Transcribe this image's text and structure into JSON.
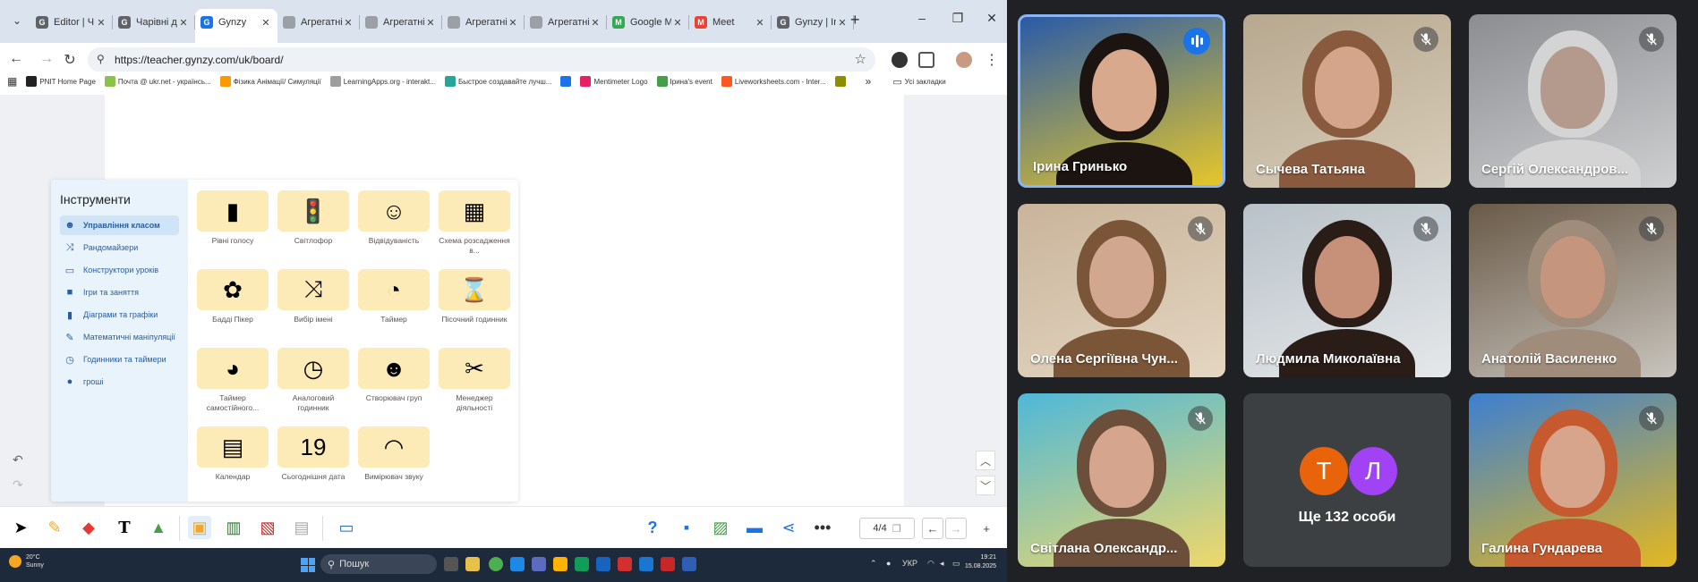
{
  "browser": {
    "tabs": [
      {
        "title": "Editor | Ч",
        "fav_color": "#5f6368",
        "fav_glyph": "G"
      },
      {
        "title": "Чарівні д",
        "fav_color": "#5f6368",
        "fav_glyph": "G"
      },
      {
        "title": "Gynzy",
        "fav_color": "#1a73e8",
        "fav_glyph": "G",
        "active": true
      },
      {
        "title": "Агрегатні",
        "fav_color": "#9aa0a6",
        "fav_glyph": ""
      },
      {
        "title": "Агрегатні",
        "fav_color": "#9aa0a6",
        "fav_glyph": ""
      },
      {
        "title": "Агрегатні",
        "fav_color": "#9aa0a6",
        "fav_glyph": ""
      },
      {
        "title": "Агрегатні",
        "fav_color": "#9aa0a6",
        "fav_glyph": ""
      },
      {
        "title": "Google M",
        "fav_color": "#34a853",
        "fav_glyph": "M"
      },
      {
        "title": "Meet",
        "fav_color": "#ea4335",
        "fav_glyph": "M"
      },
      {
        "title": "Gynzy | In",
        "fav_color": "#5f6368",
        "fav_glyph": "G"
      }
    ],
    "url": "https://teacher.gynzy.com/uk/board/",
    "bookmarks": [
      {
        "label": "PNIT Home Page",
        "color": "#222"
      },
      {
        "label": "Почта @ ukr.net - українсь...",
        "color": "#8bc34a"
      },
      {
        "label": "Фізика Анімації/ Симуляції",
        "color": "#ff9800"
      },
      {
        "label": "LearningApps.org - interakt...",
        "color": "#9e9e9e"
      },
      {
        "label": "Быстрое создавайте лучш...",
        "color": "#26a69a"
      },
      {
        "label": "",
        "color": "#1a73e8"
      },
      {
        "label": "Mentimeter Logo",
        "color": "#e91e63"
      },
      {
        "label": "Ірина's event",
        "color": "#43a047"
      },
      {
        "label": "Liveworksheets.com - Inter...",
        "color": "#ff5722"
      },
      {
        "label": "",
        "color": "#8d8d00"
      }
    ],
    "bookmarks_folder": "Усі закладки"
  },
  "tools": {
    "title": "Інструменти",
    "categories": [
      {
        "label": "Управління класом",
        "icon": "class-icon",
        "glyph": "☻",
        "active": true
      },
      {
        "label": "Рандомайзери",
        "icon": "shuffle-icon",
        "glyph": "⤨"
      },
      {
        "label": "Конструктори уроків",
        "icon": "builder-icon",
        "glyph": "▭"
      },
      {
        "label": "Ігри та заняття",
        "icon": "games-icon",
        "glyph": "■"
      },
      {
        "label": "Діаграми та графіки",
        "icon": "chart-icon",
        "glyph": "▮"
      },
      {
        "label": "Математичні маніпуляції",
        "icon": "ruler-icon",
        "glyph": "✎"
      },
      {
        "label": "Годинники та таймери",
        "icon": "clock-icon",
        "glyph": "◷"
      },
      {
        "label": "гроші",
        "icon": "coins-icon",
        "glyph": "●"
      }
    ],
    "items": [
      {
        "label": "Рівні голосу",
        "icon": "voice-level-icon",
        "glyph": "▮"
      },
      {
        "label": "Світлофор",
        "icon": "traffic-light-icon",
        "glyph": "🚦"
      },
      {
        "label": "Відвідуваність",
        "icon": "attendance-icon",
        "glyph": "☺"
      },
      {
        "label": "Схема розсадження в...",
        "icon": "seating-icon",
        "glyph": "▦"
      },
      {
        "label": "Бадді Пікер",
        "icon": "buddy-picker-icon",
        "glyph": "✿"
      },
      {
        "label": "Вибір імені",
        "icon": "name-picker-icon",
        "glyph": "⤨"
      },
      {
        "label": "Таймер",
        "icon": "timer-icon",
        "glyph": "◔"
      },
      {
        "label": "Пісочний годинник",
        "icon": "hourglass-icon",
        "glyph": "⌛"
      },
      {
        "label": "Таймер самостійного...",
        "icon": "pie-timer-icon",
        "glyph": "◕"
      },
      {
        "label": "Аналоговий годинник",
        "icon": "analog-clock-icon",
        "glyph": "◷"
      },
      {
        "label": "Створювач груп",
        "icon": "group-maker-icon",
        "glyph": "☻"
      },
      {
        "label": "Менеджер діяльності",
        "icon": "activity-manager-icon",
        "glyph": "✂"
      },
      {
        "label": "Календар",
        "icon": "calendar-icon",
        "glyph": "▤"
      },
      {
        "label": "Сьогоднішня дата",
        "icon": "today-date-icon",
        "glyph": "19"
      },
      {
        "label": "Вимірювач звуку",
        "icon": "sound-meter-icon",
        "glyph": "◠"
      }
    ]
  },
  "toolbar": {
    "page_indicator": "4/4"
  },
  "taskbar": {
    "weather_temp": "20°C",
    "weather_desc": "Sunny",
    "search_placeholder": "Пошук",
    "lang": "УКР",
    "time": "19:21",
    "date": "15.08.2025"
  },
  "meet": {
    "participants": [
      {
        "name": "Ірина Гринько",
        "speaking": true,
        "bg": "#2a5aa8",
        "bg2": "#e5c72a",
        "skin": "#d9a98e",
        "hair": "#1b1411"
      },
      {
        "name": "Сычева Татьяна",
        "muted": true,
        "bg": "#b7a88f",
        "bg2": "#d8cdb9",
        "skin": "#d4a48b",
        "hair": "#8a5a3e"
      },
      {
        "name": "Сергій Олександров...",
        "muted": true,
        "bg": "#8c8d90",
        "bg2": "#cfd0d2",
        "skin": "#b49a8c",
        "hair": "#d4d4d4"
      },
      {
        "name": "Олена Сергіївна Чун...",
        "muted": true,
        "bg": "#c9b49a",
        "bg2": "#e4d6c2",
        "skin": "#d1a78f",
        "hair": "#7a5538"
      },
      {
        "name": "Людмила Миколаївна",
        "muted": true,
        "bg": "#b9c2c9",
        "bg2": "#e5e8ea",
        "skin": "#c69178",
        "hair": "#2a1d18"
      },
      {
        "name": "Анатолій Василенко",
        "muted": true,
        "bg": "#6a5a48",
        "bg2": "#c8c4bd",
        "skin": "#c5957e",
        "hair": "#a08c7a"
      },
      {
        "name": "Світлана Олександр...",
        "muted": true,
        "bg": "#4eb8d9",
        "bg2": "#f0d86a",
        "skin": "#d6a58d",
        "hair": "#6b4f3a"
      },
      {
        "name": "Галина Гундарева",
        "muted": true,
        "bg": "#3c7fd1",
        "bg2": "#e4b820",
        "skin": "#d7a48c",
        "hair": "#c65a2e"
      }
    ],
    "more": {
      "label": "Ще 132 особи",
      "avatars": [
        {
          "letter": "Т",
          "color": "#e8630a"
        },
        {
          "letter": "Л",
          "color": "#a142f4"
        }
      ]
    }
  }
}
